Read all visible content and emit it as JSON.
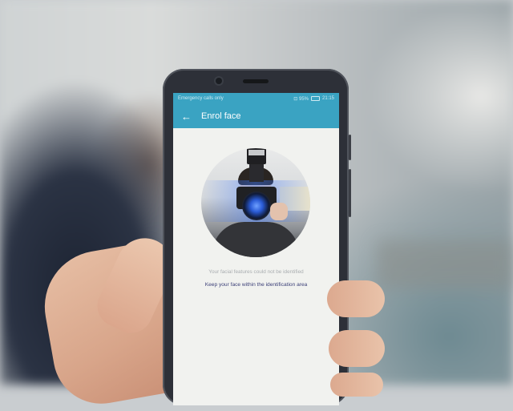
{
  "status_bar": {
    "left_text": "Emergency calls only",
    "signal_text": "⊡ 95%",
    "time": "21:15"
  },
  "header": {
    "back_icon": "←",
    "title": "Enrol face"
  },
  "messages": {
    "error": "Your facial features could not be identified",
    "instruction": "Keep your face within the identification area"
  },
  "colors": {
    "header_bg": "#3aa3c2",
    "screen_bg": "#f1f2ef",
    "instruction_text": "#3b3f77"
  }
}
